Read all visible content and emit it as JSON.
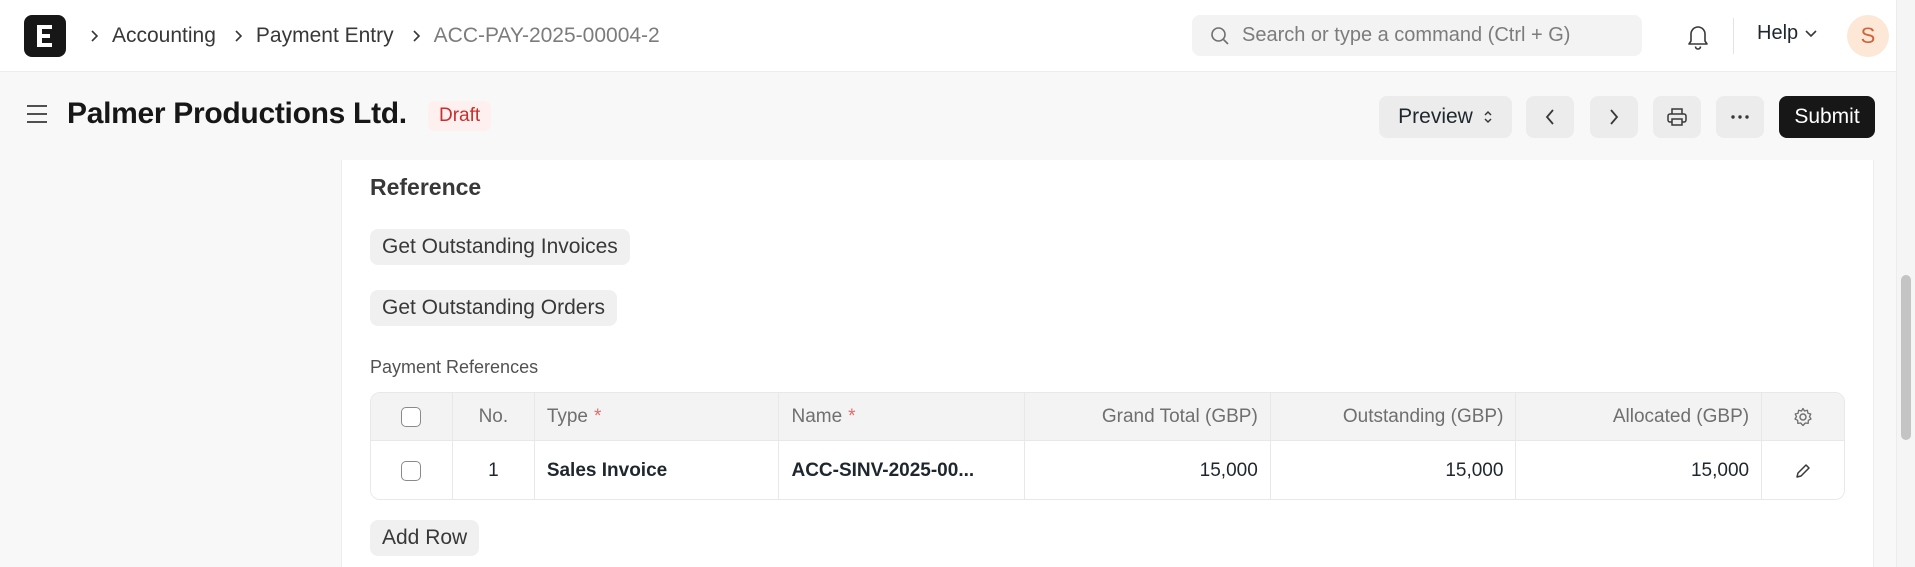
{
  "navbar": {
    "breadcrumbs": [
      "Accounting",
      "Payment Entry",
      "ACC-PAY-2025-00004-2"
    ],
    "search_placeholder": "Search or type a command (Ctrl + G)",
    "help_label": "Help",
    "avatar_initial": "S"
  },
  "page": {
    "title": "Palmer Productions Ltd.",
    "status": "Draft",
    "preview_label": "Preview",
    "submit_label": "Submit"
  },
  "reference": {
    "section_title": "Reference",
    "get_invoices_label": "Get Outstanding Invoices",
    "get_orders_label": "Get Outstanding Orders",
    "table_label": "Payment References",
    "columns": {
      "no": "No.",
      "type": "Type",
      "name": "Name",
      "grand_total": "Grand Total (GBP)",
      "outstanding": "Outstanding (GBP)",
      "allocated": "Allocated (GBP)"
    },
    "required_marker": "*",
    "rows": [
      {
        "no": "1",
        "type": "Sales Invoice",
        "name": "ACC-SINV-2025-00...",
        "grand_total": "15,000",
        "outstanding": "15,000",
        "allocated": "15,000"
      }
    ],
    "add_row_label": "Add Row"
  },
  "colors": {
    "primary_button": "#171717",
    "draft_badge_text": "#c52f2f",
    "draft_badge_bg": "#fff0f0",
    "avatar_bg": "#fde8d8",
    "avatar_text": "#d0643b"
  },
  "icons": [
    "app-logo",
    "chevron-right-icon",
    "search-icon",
    "bell-icon",
    "chevron-down-icon",
    "hamburger-icon",
    "updown-icon",
    "chevron-left-icon",
    "printer-icon",
    "ellipsis-icon",
    "gear-icon",
    "pencil-icon"
  ]
}
